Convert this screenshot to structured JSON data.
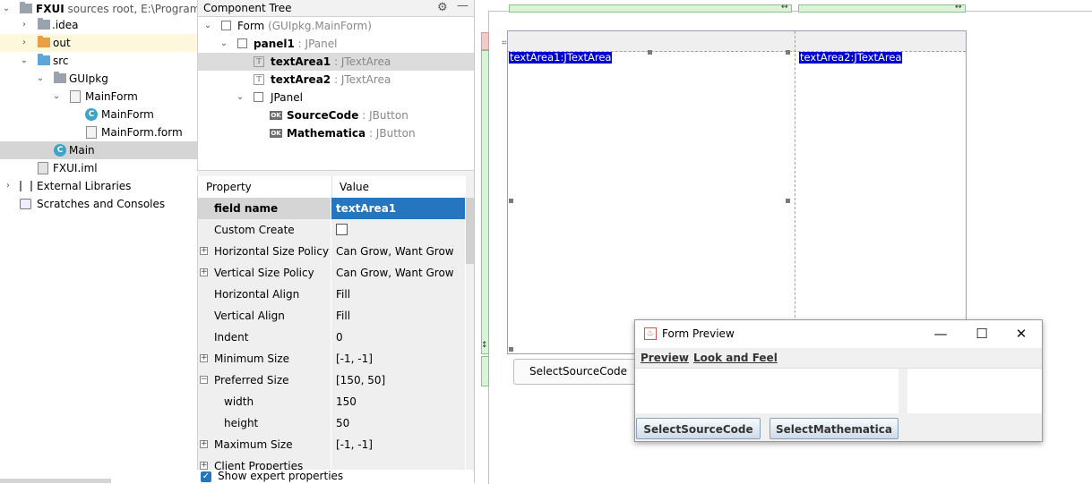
{
  "project": {
    "root": {
      "name": "FXUI",
      "path": "sources root, E:\\Programmi"
    },
    "items": [
      {
        "label": "idea",
        "prefix": "."
      },
      {
        "label": "out"
      },
      {
        "label": "src"
      },
      {
        "label": "GUIpkg"
      },
      {
        "label": "MainForm"
      },
      {
        "label": "MainForm"
      },
      {
        "label": "MainForm.form"
      },
      {
        "label": "Main"
      },
      {
        "label": "FXUI.iml"
      },
      {
        "label": "External Libraries"
      },
      {
        "label": "Scratches and Consoles"
      }
    ]
  },
  "component_tree": {
    "title": "Component Tree",
    "form": {
      "name": "Form",
      "type": "(GUIpkg.MainForm)"
    },
    "panel1": {
      "name": "panel1",
      "type": ": JPanel"
    },
    "textArea1": {
      "name": "textArea1",
      "type": ": JTextArea"
    },
    "textArea2": {
      "name": "textArea2",
      "type": ": JTextArea"
    },
    "jpanel": {
      "name": "JPanel"
    },
    "sourceCode": {
      "name": "SourceCode",
      "type": ": JButton"
    },
    "mathematica": {
      "name": "Mathematica",
      "type": ": JButton"
    },
    "ok_icon": "OK"
  },
  "properties": {
    "header": {
      "property": "Property",
      "value": "Value"
    },
    "rows": [
      {
        "name": "field name",
        "value": "textArea1"
      },
      {
        "name": "Custom Create",
        "value": ""
      },
      {
        "name": "Horizontal Size Policy",
        "value": "Can Grow, Want Grow"
      },
      {
        "name": "Vertical Size Policy",
        "value": "Can Grow, Want Grow"
      },
      {
        "name": "Horizontal Align",
        "value": "Fill"
      },
      {
        "name": "Vertical Align",
        "value": "Fill"
      },
      {
        "name": "Indent",
        "value": "0"
      },
      {
        "name": "Minimum Size",
        "value": "[-1, -1]"
      },
      {
        "name": "Preferred Size",
        "value": "[150, 50]"
      },
      {
        "name": "width",
        "value": "150"
      },
      {
        "name": "height",
        "value": "50"
      },
      {
        "name": "Maximum Size",
        "value": "[-1, -1]"
      },
      {
        "name": "Client Properties",
        "value": ""
      }
    ],
    "expand_plus": "+",
    "expand_minus": "−",
    "show_expert": "Show expert properties"
  },
  "designer": {
    "textarea1_label": "textArea1:JTextArea",
    "textarea2_label": "textArea2:JTextArea",
    "button_label": "SelectSourceCode"
  },
  "preview": {
    "title": "Form Preview",
    "menu": [
      "Preview",
      "Look and Feel"
    ],
    "buttons": [
      "SelectSourceCode",
      "SelectMathematica"
    ],
    "window_controls": {
      "minimize": "—",
      "maximize": "☐",
      "close": "✕"
    }
  },
  "colors": {
    "selection_blue": "#2675bf",
    "textarea_label_bg": "#0000cc",
    "folder_orange": "#e8a045",
    "folder_blue": "#5aa7d8",
    "folder_grey": "#9aa3ad"
  }
}
